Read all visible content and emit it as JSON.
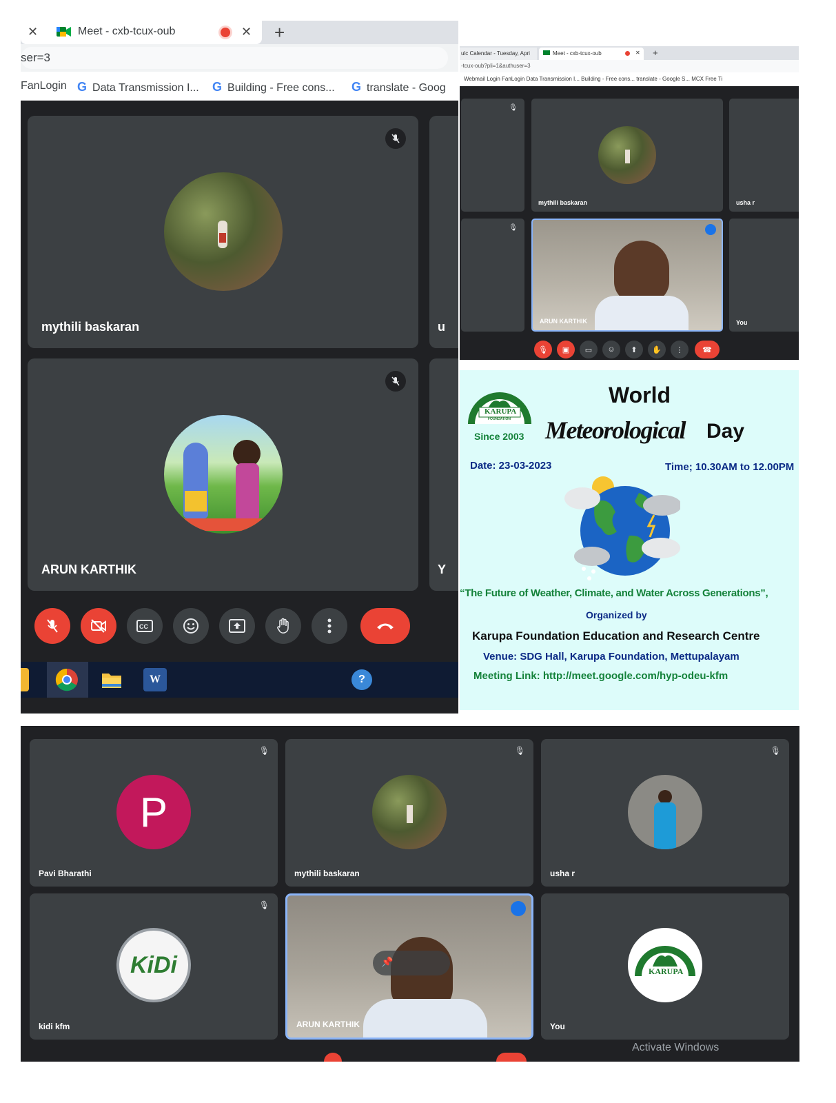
{
  "panel_a": {
    "tab_title": "Meet - cxb-tcux-oub",
    "close_glyph": "✕",
    "new_tab_glyph": "+",
    "address_text": "ser=3",
    "bookmarks": [
      "FanLogin",
      "Data Transmission I...",
      "Building - Free cons...",
      "translate - Goog"
    ],
    "participants": [
      {
        "name": "mythili baskaran"
      },
      {
        "name": "ARUN KARTHIK"
      }
    ],
    "side_letters": [
      "u",
      "Y"
    ]
  },
  "panel_b": {
    "tabs": [
      "ulc Calendar - Tuesday, Apri",
      "Meet - cxb-tcux-oub"
    ],
    "address_text": "-tcux-oub?pli=1&authuser=3",
    "bookmarks": "Webmail Login   FanLogin   Data Transmission I...   Building - Free cons...   translate - Google S...   MCX Free Ti",
    "participants": [
      "mythili baskaran",
      "usha r",
      "ARUN KARTHIK",
      "You"
    ]
  },
  "poster": {
    "title_line1": "World",
    "title_word_main": "Meteorological",
    "title_word_day": "Day",
    "logo_text": "KARUPA",
    "logo_subtext": "FOUNDATION",
    "since": "Since 2003",
    "date": "Date: 23-03-2023",
    "time": "Time; 10.30AM to 12.00PM",
    "theme": "“The Future of Weather, Climate, and Water Across Generations”,",
    "organized_by": "Organized by",
    "organizer": "Karupa Foundation Education and Research Centre",
    "venue": "Venue: SDG Hall, Karupa Foundation, Mettupalayam",
    "meeting_link": "Meeting Link: http://meet.google.com/hyp-odeu-kfm",
    "colors": {
      "background": "#ddfcfa",
      "dark_blue": "#0c2b86",
      "green": "#14823a"
    }
  },
  "panel_d": {
    "participants": [
      {
        "name": "Pavi Bharathi",
        "initial": "P"
      },
      {
        "name": "mythili baskaran"
      },
      {
        "name": "usha r"
      },
      {
        "name": "kidi kfm",
        "logo_text": "KiDi"
      },
      {
        "name": "ARUN KARTHIK"
      },
      {
        "name": "You",
        "logo_text": "KARUPA"
      }
    ],
    "watermark": "Activate Windows"
  }
}
